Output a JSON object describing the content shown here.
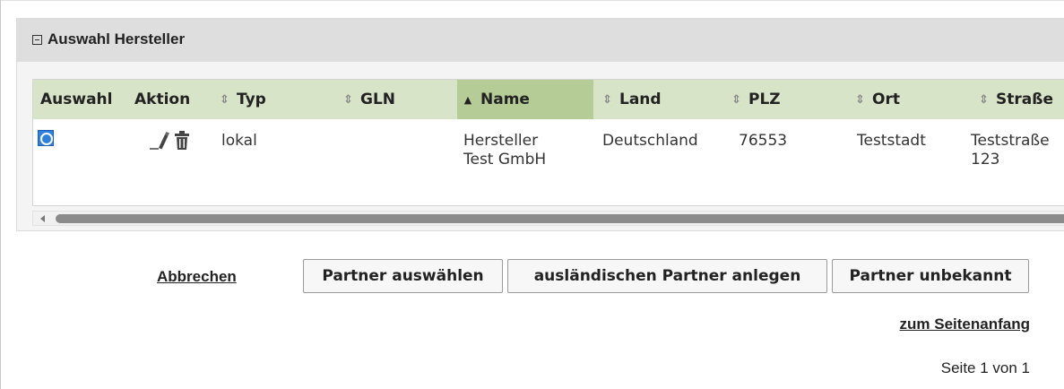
{
  "panel": {
    "title": "Auswahl Hersteller"
  },
  "table": {
    "columns": [
      {
        "key": "auswahl",
        "label": "Auswahl",
        "sortable": false
      },
      {
        "key": "aktion",
        "label": "Aktion",
        "sortable": false
      },
      {
        "key": "typ",
        "label": "Typ",
        "sortable": true,
        "sort": "none"
      },
      {
        "key": "gln",
        "label": "GLN",
        "sortable": true,
        "sort": "none"
      },
      {
        "key": "name",
        "label": "Name",
        "sortable": true,
        "sort": "ascending"
      },
      {
        "key": "land",
        "label": "Land",
        "sortable": true,
        "sort": "none"
      },
      {
        "key": "plz",
        "label": "PLZ",
        "sortable": true,
        "sort": "none"
      },
      {
        "key": "ort",
        "label": "Ort",
        "sortable": true,
        "sort": "none"
      },
      {
        "key": "strasse",
        "label": "Straße",
        "sortable": true,
        "sort": "none"
      }
    ],
    "rows": [
      {
        "selected": true,
        "typ": "lokal",
        "gln": "",
        "name_line1": "Hersteller",
        "name_line2": "Test GmbH",
        "land": "Deutschland",
        "plz": "76553",
        "ort": "Teststadt",
        "strasse_line1": "Teststraße",
        "strasse_line2": "123"
      }
    ]
  },
  "actions": {
    "cancel": "Abbrechen",
    "select_partner": "Partner auswählen",
    "create_foreign_partner": "ausländischen Partner anlegen",
    "partner_unknown": "Partner unbekannt"
  },
  "footer": {
    "to_top": "zum Seitenanfang",
    "page_info": "Seite 1 von 1"
  },
  "colors": {
    "header_bg": "#d8e4c8",
    "sorted_header_bg": "#b5cc96",
    "radio_selected": "#2f7fe0"
  }
}
